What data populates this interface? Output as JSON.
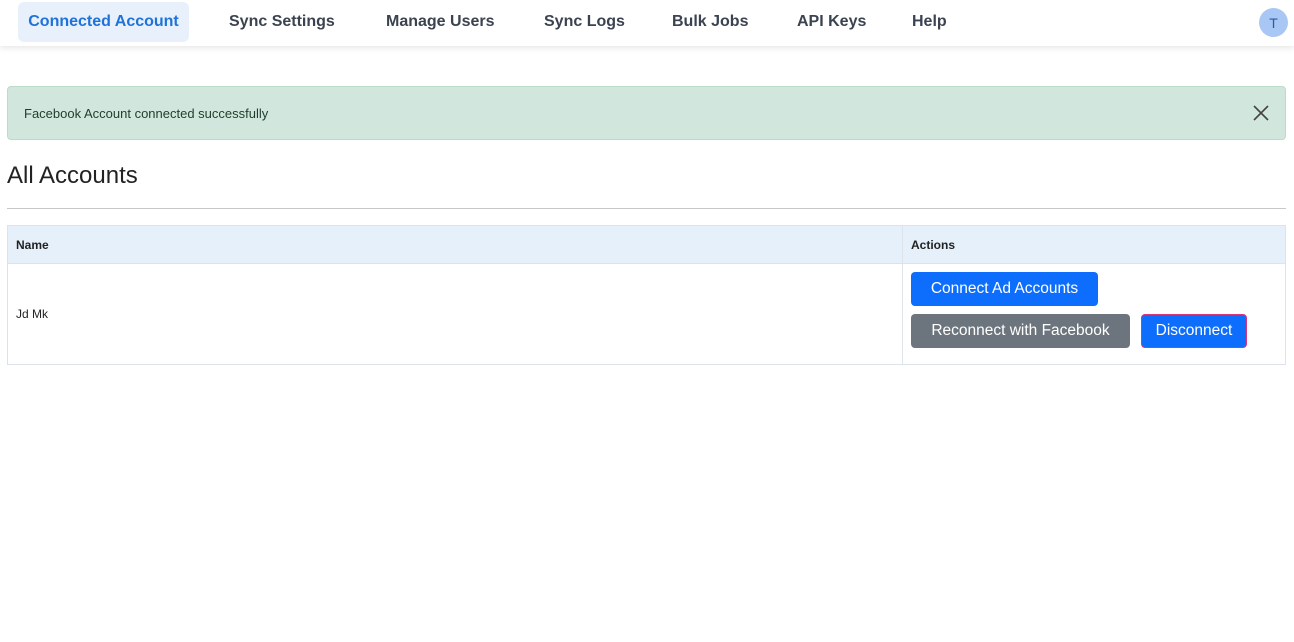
{
  "nav": {
    "tabs": [
      {
        "label": "Connected Account",
        "active": true
      },
      {
        "label": "Sync Settings"
      },
      {
        "label": "Manage Users"
      },
      {
        "label": "Sync Logs"
      },
      {
        "label": "Bulk Jobs"
      },
      {
        "label": "API Keys"
      },
      {
        "label": "Help"
      }
    ],
    "avatar_initial": "T"
  },
  "alert": {
    "message": "Facebook Account connected successfully",
    "close_icon": "close-icon"
  },
  "section": {
    "title": "All Accounts"
  },
  "table": {
    "headers": {
      "name": "Name",
      "actions": "Actions"
    },
    "rows": [
      {
        "name": "Jd Mk"
      }
    ]
  },
  "buttons": {
    "connect_ad_accounts": "Connect Ad Accounts",
    "reconnect": "Reconnect with Facebook",
    "disconnect": "Disconnect"
  },
  "colors": {
    "primary": "#0d6efd",
    "secondary": "#6c757d",
    "alert_bg": "#d1e7dd",
    "active_tab_bg": "#e7f0fb",
    "active_tab_text": "#1f72d8"
  }
}
